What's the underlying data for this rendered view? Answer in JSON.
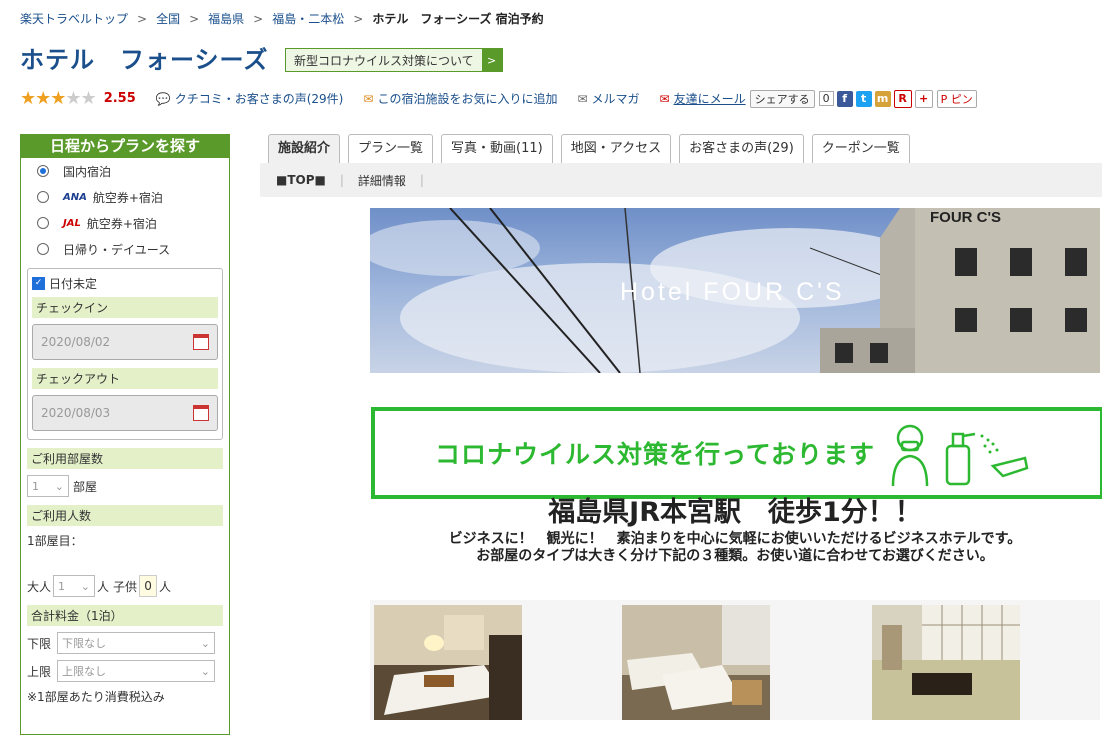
{
  "breadcrumb": [
    "楽天トラベルトップ",
    "全国",
    "福島県",
    "福島・二本松",
    "ホテル　フォーシーズ 宿泊予約"
  ],
  "hotel": {
    "name": "ホテル　フォーシーズ",
    "covid_button": "新型コロナウイルス対策について",
    "score": "2.55",
    "stars": 2.5
  },
  "links": {
    "reviews": "クチコミ・お客さまの声(29件)",
    "favorite": "この宿泊施設をお気に入りに追加",
    "mailmag": "メルマガ",
    "mail_friend": "友達にメール",
    "share": "シェアする",
    "share_count": "0",
    "pin": "ピン"
  },
  "sidebar": {
    "title": "日程からプランを探す",
    "options": [
      "国内宿泊",
      "航空券+宿泊",
      "航空券+宿泊",
      "日帰り・デイユース"
    ],
    "airlines": [
      "ANA",
      "JAL"
    ],
    "date_undecided": "日付未定",
    "checkin_label": "チェックイン",
    "checkin_placeholder": "2020/08/02",
    "checkout_label": "チェックアウト",
    "checkout_placeholder": "2020/08/03",
    "rooms_label": "ご利用部屋数",
    "rooms_value": "1",
    "rooms_unit": "部屋",
    "guests_label": "ご利用人数",
    "room1_label": "1部屋目：",
    "adult_label": "大人",
    "adult_value": "1",
    "adult_unit": "人",
    "child_label": "子供",
    "child_value": "0",
    "child_unit": "人",
    "price_label": "合計料金（1泊）",
    "min_label": "下限",
    "min_value": "下限なし",
    "max_label": "上限",
    "max_value": "上限なし",
    "tax_note": "※1部屋あたり消費税込み"
  },
  "tabs": [
    "施設紹介",
    "プラン一覧",
    "写真・動画(11)",
    "地図・アクセス",
    "お客さまの声(29)",
    "クーポン一覧"
  ],
  "subnav": [
    "■TOP■",
    "詳細情報"
  ],
  "banner_text": "Hotel FOUR C'S",
  "building_sign": "FOUR C'S",
  "covid_message": "コロナウイルス対策を行っております",
  "headline": "福島県JR本宮駅　徒歩1分！！",
  "description": [
    "ビジネスに！　観光に！　素泊まりを中心に気軽にお使いいただけるビジネスホテルです。",
    "お部屋のタイプは大きく分け下記の３種類。お使い道に合わせてお選びください。"
  ],
  "colors": {
    "brand_green": "#5a9a2a",
    "covid_green": "#2cb830",
    "link_blue": "#1a4f8b",
    "score_red": "#cc0000"
  }
}
